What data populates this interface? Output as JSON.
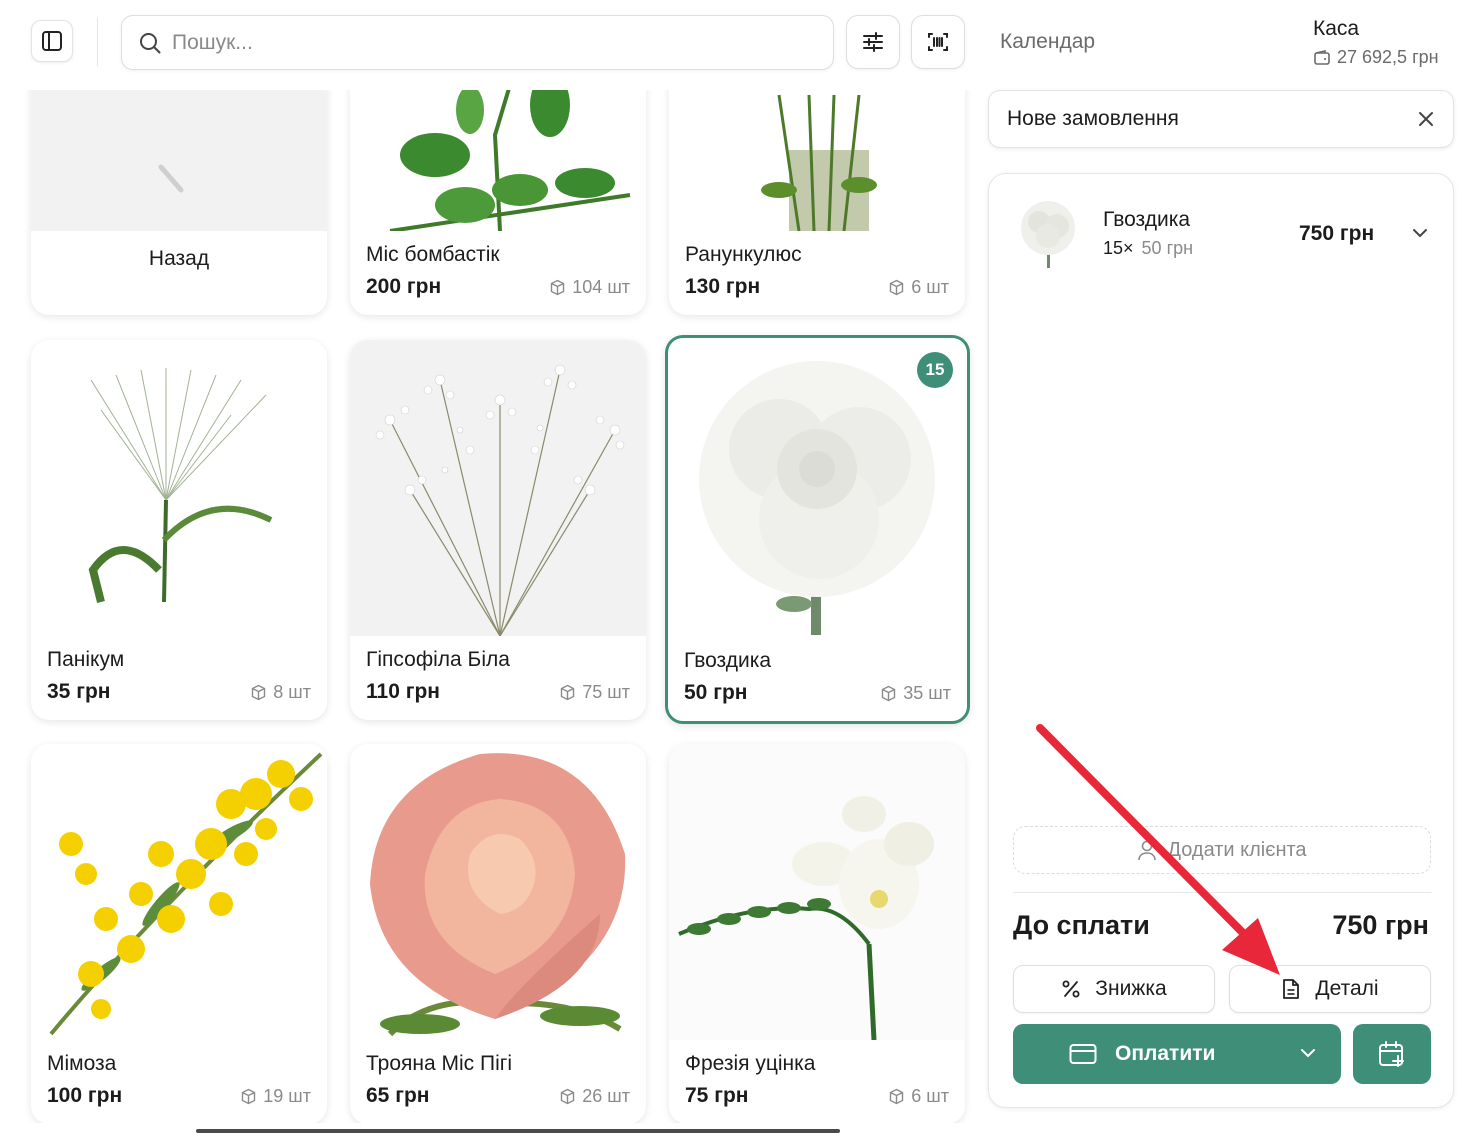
{
  "topbar": {
    "search_placeholder": "Пошук...",
    "calendar_label": "Календар",
    "kasa_title": "Каса",
    "kasa_balance": "27 692,5 грн"
  },
  "products": [
    {
      "name": "Назад",
      "is_back": true
    },
    {
      "name": "Міс бомбастік",
      "price": "200 грн",
      "stock": "104 шт"
    },
    {
      "name": "Ранункулюс",
      "price": "130 грн",
      "stock": "6 шт"
    },
    {
      "name": "Панікум",
      "price": "35 грн",
      "stock": "8 шт"
    },
    {
      "name": "Гіпсофіла Біла",
      "price": "110 грн",
      "stock": "75 шт"
    },
    {
      "name": "Гвоздика",
      "price": "50 грн",
      "stock": "35 шт",
      "selected": true,
      "badge": "15"
    },
    {
      "name": "Мімоза",
      "price": "100 грн",
      "stock": "19 шт"
    },
    {
      "name": "Трояна Міс Пігі",
      "price": "65 грн",
      "stock": "26 шт"
    },
    {
      "name": "Фрезія уцінка",
      "price": "75 грн",
      "stock": "6 шт"
    }
  ],
  "order": {
    "title": "Нове замовлення",
    "items": [
      {
        "name": "Гвоздика",
        "qty": "15×",
        "unit_price": "50 грн",
        "total": "750 грн"
      }
    ],
    "add_client_label": "Додати клієнта",
    "due_label": "До сплати",
    "due_amount": "750 грн",
    "discount_label": "Знижка",
    "details_label": "Деталі",
    "pay_label": "Оплатити"
  },
  "colors": {
    "accent": "#3f8f78",
    "annotation_arrow": "#e8283a"
  }
}
